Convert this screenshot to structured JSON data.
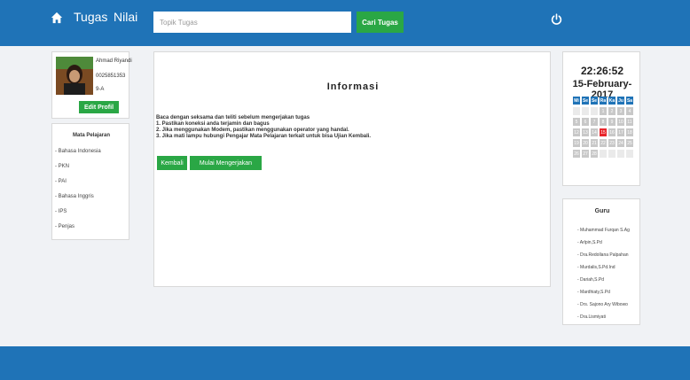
{
  "navbar": {
    "brand_tugas": "Tugas",
    "brand_nilai": "Nilai",
    "search_placeholder": "Topik Tugas",
    "search_button": "Cari Tugas",
    "home_icon": "home-icon",
    "power_icon": "power-icon"
  },
  "profile": {
    "name": "Ahmad Riyandi",
    "nis": "0025851353",
    "kelas": "9-A",
    "edit_button": "Edit Profil"
  },
  "mata_pelajaran": {
    "title": "Mata Pelajaran",
    "items": [
      "- Bahasa Indonesia",
      "- PKN",
      "- PAI",
      "- Bahasa Inggris",
      "- IPS",
      "- Penjas"
    ]
  },
  "informasi": {
    "title": "Informasi",
    "lines": [
      "Baca dengan seksama dan teliti sebelum mengerjakan tugas",
      "1. Pastikan koneksi anda terjamin dan bagus",
      "2. Jika menggunakan Modem, pastikan menggunakan operator yang handal.",
      "3. Jika mati lampu hubungi Pengajar Mata Pelajaran terkait untuk bisa Ujian Kembali."
    ],
    "kembali_button": "Kembali",
    "mulai_button": "Mulai Mengerjakan"
  },
  "clock": {
    "time": "22:26:52",
    "date": "15-February-2017",
    "day_headers": [
      "Mi",
      "Se",
      "Se",
      "Ra",
      "Ka",
      "Ju",
      "Sa"
    ],
    "weeks": [
      [
        "",
        "",
        "",
        "1",
        "2",
        "3",
        "4"
      ],
      [
        "5",
        "6",
        "7",
        "8",
        "9",
        "10",
        "11"
      ],
      [
        "12",
        "13",
        "14",
        "15",
        "16",
        "17",
        "18"
      ],
      [
        "19",
        "20",
        "21",
        "22",
        "23",
        "24",
        "25"
      ],
      [
        "26",
        "27",
        "28",
        "",
        "",
        "",
        ""
      ]
    ],
    "today": "15"
  },
  "guru": {
    "title": "Guru",
    "items": [
      "- Muhammad Furqan S.Ag",
      "- Arlpin,S.Pd",
      "- Dra.Redollana Palpahan",
      "- Murdalis,S.Pd.Ind",
      "- Dariah,S.Pd",
      "- Mardhiaty,S.Pd",
      "- Drs. Sajono Ary Wibowo",
      "- Dra.Lismiyati"
    ]
  },
  "colors": {
    "primary": "#1f73b7",
    "success": "#2aa745",
    "today": "#e8252b"
  }
}
